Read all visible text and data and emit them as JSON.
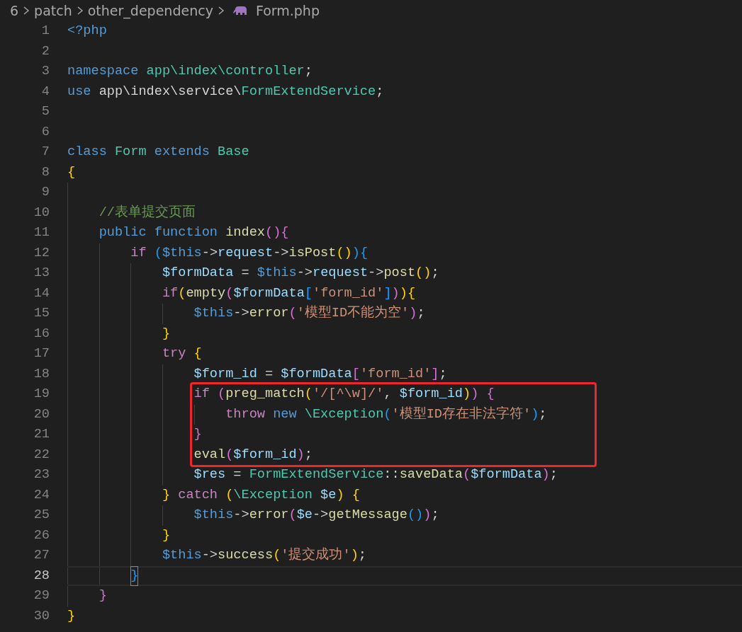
{
  "breadcrumb": {
    "folders": [
      "6",
      "patch",
      "other_dependency"
    ],
    "file": "Form.php"
  },
  "lines": [
    {
      "number": "1",
      "tokens": [
        {
          "kind": "tag",
          "text": "<?php"
        }
      ]
    },
    {
      "number": "2"
    },
    {
      "number": "3",
      "tokens": [
        {
          "kind": "keyword",
          "text": "namespace "
        },
        {
          "kind": "class",
          "text": "app\\index\\controller"
        },
        {
          "kind": "plain",
          "text": ";"
        }
      ]
    },
    {
      "number": "4",
      "tokens": [
        {
          "kind": "keyword",
          "text": "use "
        },
        {
          "kind": "plain",
          "text": "app\\index\\service\\"
        },
        {
          "kind": "class",
          "text": "FormExtendService"
        },
        {
          "kind": "plain",
          "text": ";"
        }
      ]
    },
    {
      "number": "5"
    },
    {
      "number": "6"
    },
    {
      "number": "7",
      "tokens": [
        {
          "kind": "keyword",
          "text": "class "
        },
        {
          "kind": "class",
          "text": "Form "
        },
        {
          "kind": "keyword",
          "text": "extends "
        },
        {
          "kind": "class",
          "text": "Base"
        }
      ]
    },
    {
      "number": "8",
      "tokens": [
        {
          "kind": "bracket1",
          "text": "{"
        }
      ]
    },
    {
      "number": "9"
    },
    {
      "number": "10",
      "tokens": [
        {
          "kind": "comment",
          "text": "    //表单提交页面"
        }
      ]
    },
    {
      "number": "11",
      "tokens": [
        {
          "kind": "keyword",
          "text": "    public "
        },
        {
          "kind": "keyword",
          "text": "function "
        },
        {
          "kind": "function",
          "text": "index"
        },
        {
          "kind": "bracket2",
          "text": "(){"
        }
      ]
    },
    {
      "number": "12",
      "tokens": [
        {
          "kind": "control",
          "text": "        if "
        },
        {
          "kind": "bracket3",
          "text": "("
        },
        {
          "kind": "this",
          "text": "$this"
        },
        {
          "kind": "plain",
          "text": "->"
        },
        {
          "kind": "property",
          "text": "request"
        },
        {
          "kind": "plain",
          "text": "->"
        },
        {
          "kind": "function",
          "text": "isPost"
        },
        {
          "kind": "bracket1",
          "text": "()"
        },
        {
          "kind": "bracket3",
          "text": "){"
        }
      ]
    },
    {
      "number": "13",
      "tokens": [
        {
          "kind": "variable",
          "text": "            $formData"
        },
        {
          "kind": "plain",
          "text": " = "
        },
        {
          "kind": "this",
          "text": "$this"
        },
        {
          "kind": "plain",
          "text": "->"
        },
        {
          "kind": "property",
          "text": "request"
        },
        {
          "kind": "plain",
          "text": "->"
        },
        {
          "kind": "function",
          "text": "post"
        },
        {
          "kind": "bracket1",
          "text": "()"
        },
        {
          "kind": "plain",
          "text": ";"
        }
      ]
    },
    {
      "number": "14",
      "tokens": [
        {
          "kind": "control",
          "text": "            if"
        },
        {
          "kind": "bracket1",
          "text": "("
        },
        {
          "kind": "function",
          "text": "empty"
        },
        {
          "kind": "bracket2",
          "text": "("
        },
        {
          "kind": "variable",
          "text": "$formData"
        },
        {
          "kind": "bracket3",
          "text": "["
        },
        {
          "kind": "string",
          "text": "'form_id'"
        },
        {
          "kind": "bracket3",
          "text": "]"
        },
        {
          "kind": "bracket2",
          "text": ")"
        },
        {
          "kind": "bracket1",
          "text": "){"
        }
      ]
    },
    {
      "number": "15",
      "tokens": [
        {
          "kind": "this",
          "text": "                $this"
        },
        {
          "kind": "plain",
          "text": "->"
        },
        {
          "kind": "function",
          "text": "error"
        },
        {
          "kind": "bracket2",
          "text": "("
        },
        {
          "kind": "string",
          "text": "'模型ID不能为空'"
        },
        {
          "kind": "bracket2",
          "text": ")"
        },
        {
          "kind": "plain",
          "text": ";"
        }
      ]
    },
    {
      "number": "16",
      "tokens": [
        {
          "kind": "bracket1",
          "text": "            }"
        }
      ]
    },
    {
      "number": "17",
      "tokens": [
        {
          "kind": "control",
          "text": "            try "
        },
        {
          "kind": "bracket1",
          "text": "{"
        }
      ]
    },
    {
      "number": "18",
      "tokens": [
        {
          "kind": "variable",
          "text": "                $form_id"
        },
        {
          "kind": "plain",
          "text": " = "
        },
        {
          "kind": "variable",
          "text": "$formData"
        },
        {
          "kind": "bracket2",
          "text": "["
        },
        {
          "kind": "string",
          "text": "'form_id'"
        },
        {
          "kind": "bracket2",
          "text": "]"
        },
        {
          "kind": "plain",
          "text": ";"
        }
      ]
    },
    {
      "number": "19",
      "boxed": true,
      "tokens": [
        {
          "kind": "control",
          "text": "                if "
        },
        {
          "kind": "bracket2",
          "text": "("
        },
        {
          "kind": "function",
          "text": "preg_match"
        },
        {
          "kind": "bracket1",
          "text": "("
        },
        {
          "kind": "string",
          "text": "'/[^\\w]/'"
        },
        {
          "kind": "plain",
          "text": ", "
        },
        {
          "kind": "variable",
          "text": "$form_id"
        },
        {
          "kind": "bracket1",
          "text": ")"
        },
        {
          "kind": "bracket2",
          "text": ") {"
        }
      ]
    },
    {
      "number": "20",
      "boxed": true,
      "tokens": [
        {
          "kind": "control",
          "text": "                    throw "
        },
        {
          "kind": "keyword",
          "text": "new "
        },
        {
          "kind": "class",
          "text": "\\Exception"
        },
        {
          "kind": "bracket3",
          "text": "("
        },
        {
          "kind": "string",
          "text": "'模型ID存在非法字符'"
        },
        {
          "kind": "bracket3",
          "text": ")"
        },
        {
          "kind": "plain",
          "text": ";"
        }
      ]
    },
    {
      "number": "21",
      "boxed": true,
      "tokens": [
        {
          "kind": "bracket2",
          "text": "                }"
        }
      ]
    },
    {
      "number": "22",
      "boxed": true,
      "tokens": [
        {
          "kind": "function",
          "text": "                eval"
        },
        {
          "kind": "bracket2",
          "text": "("
        },
        {
          "kind": "variable",
          "text": "$form_id"
        },
        {
          "kind": "bracket2",
          "text": ")"
        },
        {
          "kind": "plain",
          "text": ";"
        }
      ]
    },
    {
      "number": "23",
      "tokens": [
        {
          "kind": "variable",
          "text": "                $res"
        },
        {
          "kind": "plain",
          "text": " = "
        },
        {
          "kind": "class",
          "text": "FormExtendService"
        },
        {
          "kind": "plain",
          "text": "::"
        },
        {
          "kind": "function",
          "text": "saveData"
        },
        {
          "kind": "bracket2",
          "text": "("
        },
        {
          "kind": "variable",
          "text": "$formData"
        },
        {
          "kind": "bracket2",
          "text": ")"
        },
        {
          "kind": "plain",
          "text": ";"
        }
      ]
    },
    {
      "number": "24",
      "tokens": [
        {
          "kind": "bracket1",
          "text": "            } "
        },
        {
          "kind": "control",
          "text": "catch "
        },
        {
          "kind": "bracket1",
          "text": "("
        },
        {
          "kind": "class",
          "text": "\\Exception "
        },
        {
          "kind": "variable",
          "text": "$e"
        },
        {
          "kind": "bracket1",
          "text": ") {"
        }
      ]
    },
    {
      "number": "25",
      "tokens": [
        {
          "kind": "this",
          "text": "                $this"
        },
        {
          "kind": "plain",
          "text": "->"
        },
        {
          "kind": "function",
          "text": "error"
        },
        {
          "kind": "bracket2",
          "text": "("
        },
        {
          "kind": "variable",
          "text": "$e"
        },
        {
          "kind": "plain",
          "text": "->"
        },
        {
          "kind": "function",
          "text": "getMessage"
        },
        {
          "kind": "bracket3",
          "text": "()"
        },
        {
          "kind": "bracket2",
          "text": ")"
        },
        {
          "kind": "plain",
          "text": ";"
        }
      ]
    },
    {
      "number": "26",
      "tokens": [
        {
          "kind": "bracket1",
          "text": "            }"
        }
      ]
    },
    {
      "number": "27",
      "tokens": [
        {
          "kind": "this",
          "text": "            $this"
        },
        {
          "kind": "plain",
          "text": "->"
        },
        {
          "kind": "function",
          "text": "success"
        },
        {
          "kind": "bracket1",
          "text": "("
        },
        {
          "kind": "string",
          "text": "'提交成功'"
        },
        {
          "kind": "bracket1",
          "text": ")"
        },
        {
          "kind": "plain",
          "text": ";"
        }
      ]
    },
    {
      "number": "28",
      "current": true,
      "tokens": [
        {
          "kind": "bracket3",
          "text": "        }",
          "matched": true
        }
      ]
    },
    {
      "number": "29",
      "tokens": [
        {
          "kind": "bracket2",
          "text": "    }"
        }
      ]
    },
    {
      "number": "30",
      "tokens": [
        {
          "kind": "bracket1",
          "text": "}"
        }
      ]
    }
  ]
}
